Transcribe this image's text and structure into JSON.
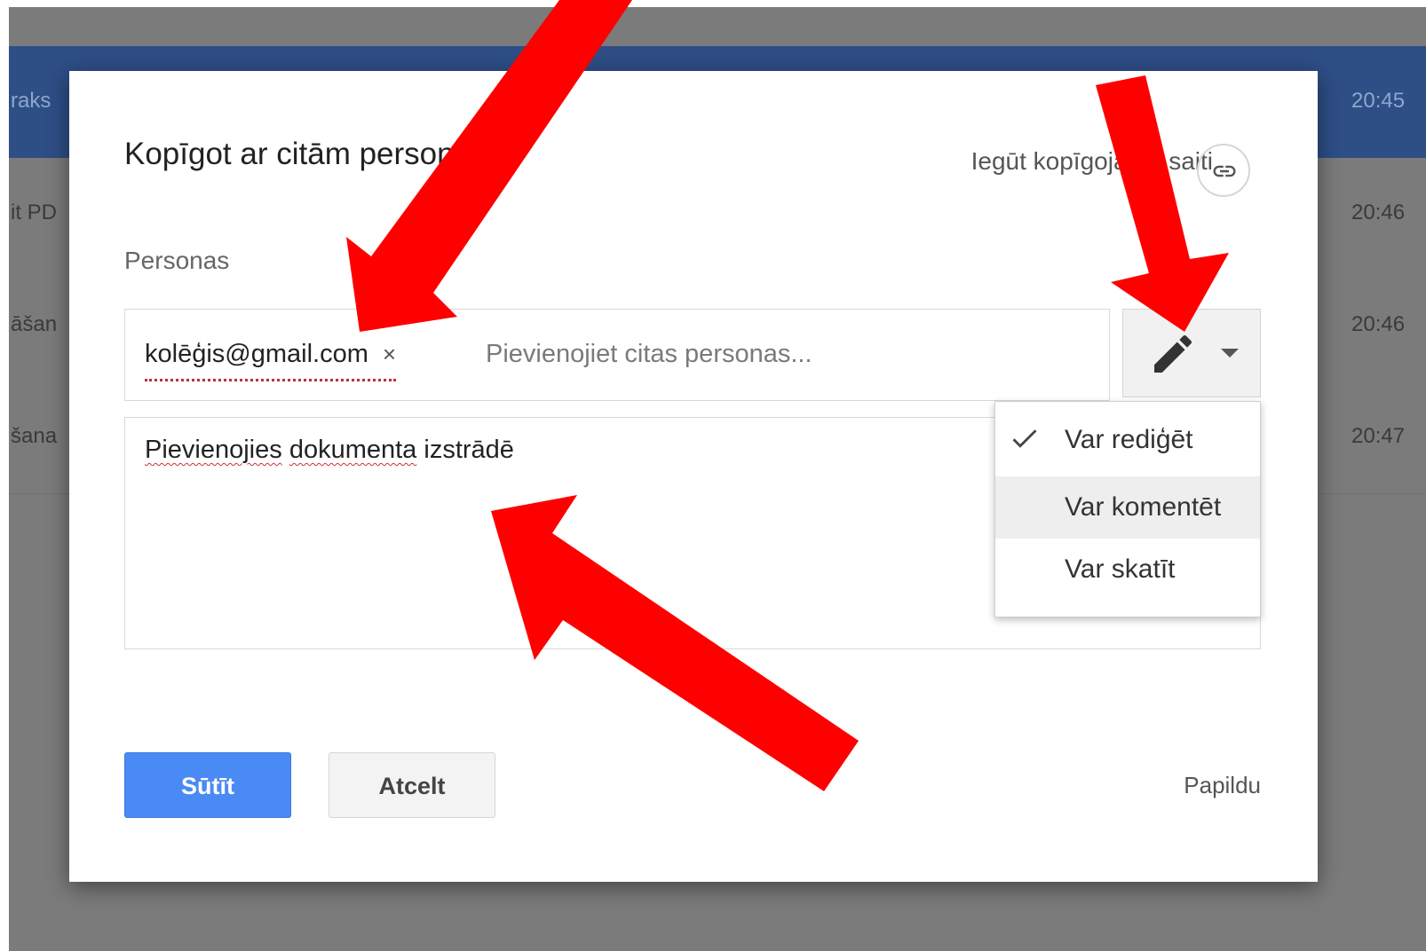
{
  "background": {
    "rows": [
      {
        "left_text": "raks",
        "time": "20:45",
        "selected": true
      },
      {
        "left_text": "it PD",
        "time": "20:46",
        "selected": false
      },
      {
        "left_text": "āšan",
        "time": "20:46",
        "selected": false
      },
      {
        "left_text": "šana",
        "time": "20:47",
        "selected": false
      }
    ]
  },
  "dialog": {
    "title": "Kopīgot ar citām personām",
    "share_link_label": "Iegūt kopīgojamo saiti",
    "persons_label": "Personas",
    "chip_email": "kolēģis@gmail.com",
    "chip_remove": "×",
    "people_placeholder": "Pievienojiet citas personas...",
    "message_prefix_1": "Pievienojies",
    "message_prefix_2": "dokumenta",
    "message_rest": "izstrādē",
    "permission_menu": [
      {
        "label": "Var rediģēt",
        "checked": true
      },
      {
        "label": "Var komentēt",
        "hovered": true
      },
      {
        "label": "Var skatīt"
      }
    ],
    "send_label": "Sūtīt",
    "cancel_label": "Atcelt",
    "more_label": "Papildu"
  },
  "icons": {
    "link": "link-icon",
    "permission": "pencil-icon",
    "caret": "caret-down-icon",
    "check": "check-icon"
  },
  "colors": {
    "primary_button": "#4a8af4",
    "annotation_arrow": "#ff0000",
    "selected_row": "#2e4e86"
  }
}
